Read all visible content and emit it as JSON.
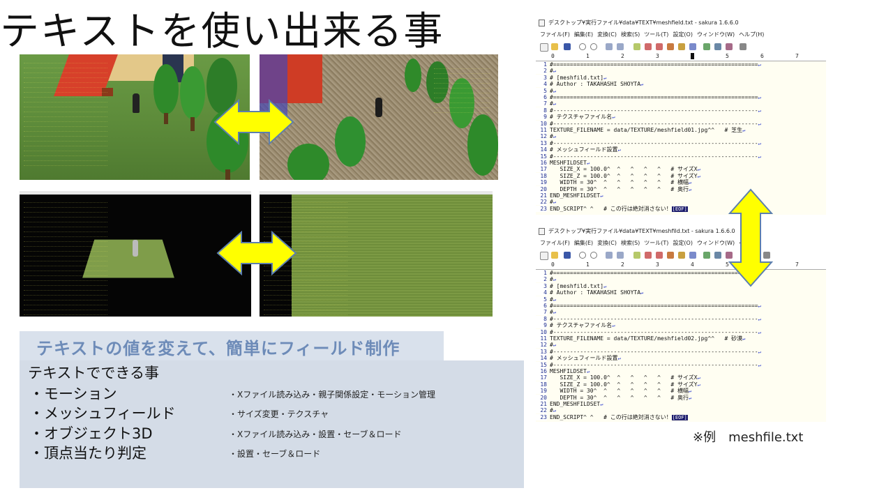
{
  "title": "テキストを使い出来る事",
  "banner": "テキストの値を変えて、簡単にフィールド制作",
  "panel": {
    "heading": "テキストでできる事",
    "features": [
      {
        "name": "・モーション",
        "desc": "・Xファイル読み込み・親子関係設定・モーション管理"
      },
      {
        "name": "・メッシュフィールド",
        "desc": "・サイズ変更・テクスチャ"
      },
      {
        "name": "・オブジェクト3D",
        "desc": "・Xファイル読み込み・設置・セーブ＆ロード"
      },
      {
        "name": "・頂点当たり判定",
        "desc": "・設置・セーブ＆ロード"
      }
    ]
  },
  "caption": "※例　meshfile.txt",
  "colors": {
    "arrow": "#ffff00",
    "arrow_outline": "#5c7fae",
    "hud_text": "#e8e86a",
    "grass": "#6f9a3e",
    "sand": "#9a8a6e",
    "panel": "#d4dce7",
    "banner": "#d9e1ec",
    "banner_text": "#6d8bb8"
  },
  "editor_top": {
    "title": "デスクトップ¥実行ファイル¥data¥TEXT¥meshfield.txt - sakura 1.6.6.0",
    "menu": [
      "ファイル(F)",
      "編集(E)",
      "変換(C)",
      "検索(S)",
      "ツール(T)",
      "設定(O)",
      "ウィンドウ(W)",
      "ヘルプ(H)"
    ],
    "ruler": [
      "0",
      "1",
      "2",
      "3",
      "4",
      "5",
      "6",
      "7"
    ],
    "lines": [
      {
        "n": "1",
        "t": "#=============================================================",
        "sep": true
      },
      {
        "n": "2",
        "t": "#"
      },
      {
        "n": "3",
        "t": "# [meshfild.txt]"
      },
      {
        "n": "4",
        "t": "# Author : TAKAHASHI SHOYTA"
      },
      {
        "n": "5",
        "t": "#"
      },
      {
        "n": "6",
        "t": "#=============================================================",
        "sep": true
      },
      {
        "n": "7",
        "t": "#"
      },
      {
        "n": "8",
        "t": "#-------------------------------------------------------------",
        "sep": true
      },
      {
        "n": "9",
        "t": "# テクスチャファイル名"
      },
      {
        "n": "10",
        "t": "#-------------------------------------------------------------",
        "sep": true
      },
      {
        "n": "11",
        "t": "TEXTURE_FILENAME = data/TEXTURE/meshfield01.jpg^^   # 芝生"
      },
      {
        "n": "12",
        "t": "#"
      },
      {
        "n": "13",
        "t": "#-------------------------------------------------------------",
        "sep": true
      },
      {
        "n": "14",
        "t": "# メッシュフィールド設置"
      },
      {
        "n": "15",
        "t": "#-------------------------------------------------------------",
        "sep": true
      },
      {
        "n": "16",
        "t": "MESHFILDSET"
      },
      {
        "n": "17",
        "t": "   SIZE_X = 100.0^  ^   ^   ^   ^   # サイズX"
      },
      {
        "n": "18",
        "t": "   SIZE_Z = 100.0^  ^   ^   ^   ^   # サイズY"
      },
      {
        "n": "19",
        "t": "   WIDTH = 30^  ^   ^   ^   ^   ^   # 横幅"
      },
      {
        "n": "20",
        "t": "   DEPTH = 30^  ^   ^   ^   ^   ^   # 奥行"
      },
      {
        "n": "21",
        "t": "END_MESHFILDSET"
      },
      {
        "n": "22",
        "t": "#"
      },
      {
        "n": "23",
        "t": "END_SCRIPT^ ^   # この行は絶対消さない！",
        "eof": "[EOF]"
      }
    ]
  },
  "editor_bottom": {
    "title": "デスクトップ¥実行ファイル¥data¥TEXT¥meshfild.txt - sakura 1.6.6.0",
    "menu": [
      "ファイル(F)",
      "編集(E)",
      "変換(C)",
      "検索(S)",
      "ツール(T)",
      "設定(O)",
      "ウィンドウ(W)",
      "ヘル"
    ],
    "ruler": [
      "0",
      "1",
      "2",
      "3",
      "4",
      "5",
      "6",
      "7"
    ],
    "lines": [
      {
        "n": "1",
        "t": "#=============================================================",
        "sep": true
      },
      {
        "n": "2",
        "t": "#"
      },
      {
        "n": "3",
        "t": "# [meshfild.txt]"
      },
      {
        "n": "4",
        "t": "# Author : TAKAHASHI SHOYTA"
      },
      {
        "n": "5",
        "t": "#"
      },
      {
        "n": "6",
        "t": "#=============================================================",
        "sep": true
      },
      {
        "n": "7",
        "t": "#"
      },
      {
        "n": "8",
        "t": "#-------------------------------------------------------------",
        "sep": true
      },
      {
        "n": "9",
        "t": "# テクスチャファイル名"
      },
      {
        "n": "10",
        "t": "#-------------------------------------------------------------",
        "sep": true
      },
      {
        "n": "11",
        "t": "TEXTURE_FILENAME = data/TEXTURE/meshfield02.jpg^^   # 砂漠"
      },
      {
        "n": "12",
        "t": "#"
      },
      {
        "n": "13",
        "t": "#-------------------------------------------------------------",
        "sep": true
      },
      {
        "n": "14",
        "t": "# メッシュフィールド設置"
      },
      {
        "n": "15",
        "t": "#-------------------------------------------------------------",
        "sep": true
      },
      {
        "n": "16",
        "t": "MESHFILDSET"
      },
      {
        "n": "17",
        "t": "   SIZE_X = 100.0^  ^   ^   ^   ^   # サイズX"
      },
      {
        "n": "18",
        "t": "   SIZE_Z = 100.0^  ^   ^   ^   ^   # サイズY"
      },
      {
        "n": "19",
        "t": "   WIDTH = 30^  ^   ^   ^   ^   ^   # 横幅"
      },
      {
        "n": "20",
        "t": "   DEPTH = 30^  ^   ^   ^   ^   ^   # 奥行"
      },
      {
        "n": "21",
        "t": "END_MESHFILDSET"
      },
      {
        "n": "22",
        "t": "#"
      },
      {
        "n": "23",
        "t": "END_SCRIPT^ ^   # この行は絶対消さない！",
        "eof": "[EOF]"
      }
    ]
  }
}
